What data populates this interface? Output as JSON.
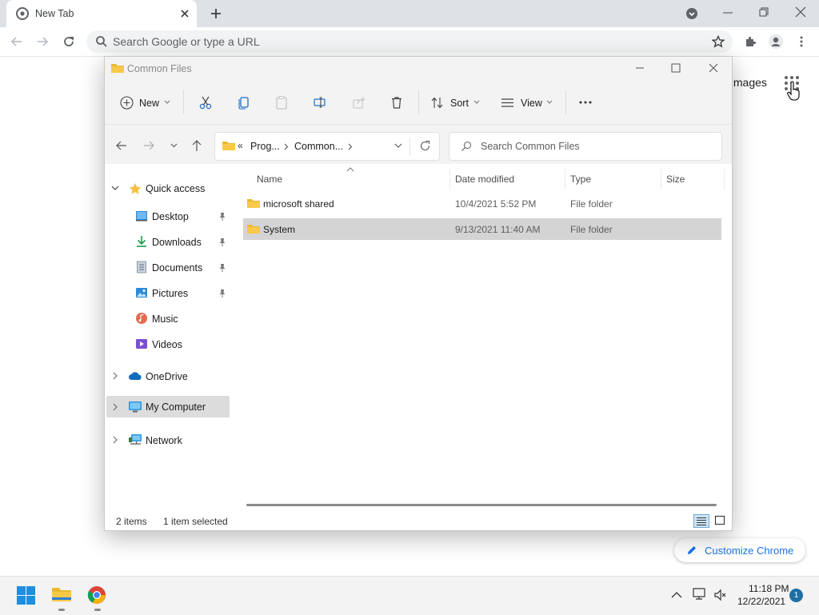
{
  "browser": {
    "tab_title": "New Tab",
    "omnibox_placeholder": "Search Google or type a URL",
    "images_link": "Images",
    "customize_label": "Customize Chrome"
  },
  "explorer": {
    "title": "Common Files",
    "toolbar": {
      "new_label": "New",
      "sort_label": "Sort",
      "view_label": "View"
    },
    "breadcrumb": {
      "prefix": "«",
      "segments": [
        "Prog...",
        "Common..."
      ]
    },
    "search_placeholder": "Search Common Files",
    "columns": {
      "name": "Name",
      "date": "Date modified",
      "type": "Type",
      "size": "Size"
    },
    "nav": {
      "quick_access": "Quick access",
      "items": [
        {
          "label": "Desktop",
          "icon": "desktop-icon",
          "pinned": true
        },
        {
          "label": "Downloads",
          "icon": "download-icon",
          "pinned": true
        },
        {
          "label": "Documents",
          "icon": "documents-icon",
          "pinned": true
        },
        {
          "label": "Pictures",
          "icon": "pictures-icon",
          "pinned": true
        },
        {
          "label": "Music",
          "icon": "music-icon",
          "pinned": false
        },
        {
          "label": "Videos",
          "icon": "videos-icon",
          "pinned": false
        }
      ],
      "onedrive": "OneDrive",
      "my_computer": "My Computer",
      "network": "Network"
    },
    "rows": [
      {
        "name": "microsoft shared",
        "date": "10/4/2021 5:52 PM",
        "type": "File folder",
        "size": ""
      },
      {
        "name": "System",
        "date": "9/13/2021 11:40 AM",
        "type": "File folder",
        "size": ""
      }
    ],
    "status": {
      "item_count": "2 items",
      "selection": "1 item selected"
    }
  },
  "taskbar": {
    "time": "11:18 PM",
    "date": "12/22/2021",
    "notification_count": "1"
  },
  "colors": {
    "accent": "#0067c0",
    "folder": "#f8c948",
    "selected_row": "#cce8ff"
  }
}
